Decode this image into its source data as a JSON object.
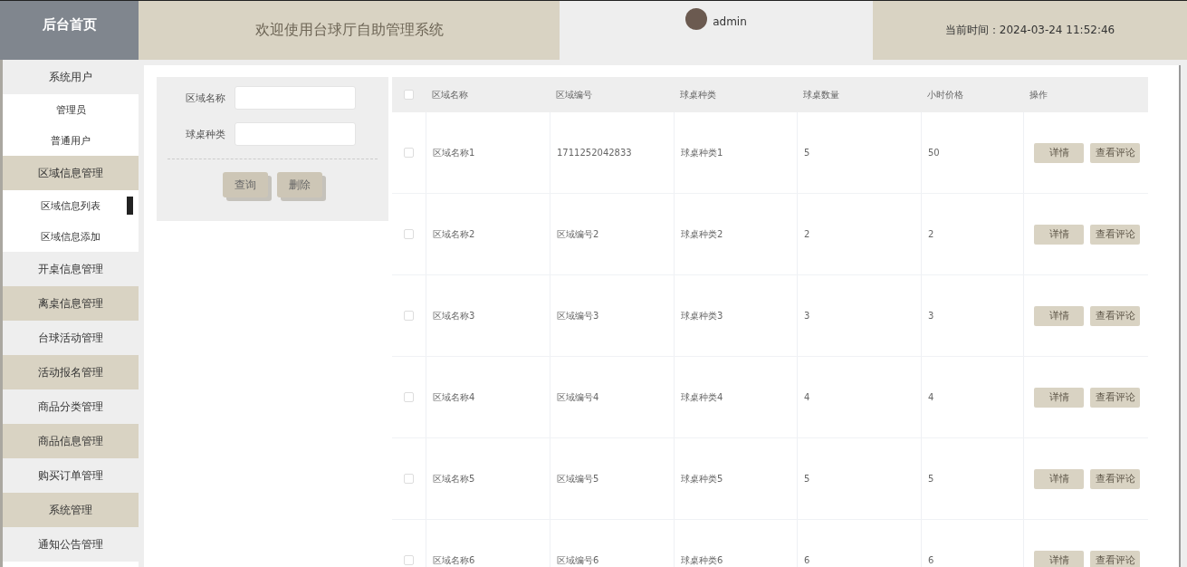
{
  "header": {
    "home": "后台首页",
    "title": "欢迎使用台球厅自助管理系统",
    "user": "admin",
    "time": "当前时间：2024-03-24 11:52:46"
  },
  "sidebar": {
    "items": [
      {
        "label": "系统用户",
        "children": [
          {
            "label": "管理员",
            "selected": false
          },
          {
            "label": "普通用户",
            "selected": false
          }
        ]
      },
      {
        "label": "区域信息管理",
        "children": [
          {
            "label": "区域信息列表",
            "selected": true
          },
          {
            "label": "区域信息添加",
            "selected": false
          }
        ]
      },
      {
        "label": "开桌信息管理"
      },
      {
        "label": "离桌信息管理"
      },
      {
        "label": "台球活动管理"
      },
      {
        "label": "活动报名管理"
      },
      {
        "label": "商品分类管理"
      },
      {
        "label": "商品信息管理"
      },
      {
        "label": "购买订单管理"
      },
      {
        "label": "系统管理"
      },
      {
        "label": "通知公告管理"
      }
    ]
  },
  "search": {
    "fields": [
      {
        "label": "区域名称"
      },
      {
        "label": "球桌种类"
      }
    ],
    "buttons": [
      "查询",
      "删除"
    ]
  },
  "table": {
    "header_checked": false,
    "columns": [
      "区域名称",
      "区域编号",
      "球桌种类",
      "球桌数量",
      "小时价格",
      "操作"
    ],
    "rows": [
      {
        "checked": false,
        "cells": [
          "区域名称1",
          "1711252042833",
          "球桌种类1",
          "5",
          "50"
        ],
        "actions": [
          "详情",
          "查看评论"
        ]
      },
      {
        "checked": false,
        "cells": [
          "区域名称2",
          "区域编号2",
          "球桌种类2",
          "2",
          "2"
        ],
        "actions": [
          "详情",
          "查看评论"
        ]
      },
      {
        "checked": false,
        "cells": [
          "区域名称3",
          "区域编号3",
          "球桌种类3",
          "3",
          "3"
        ],
        "actions": [
          "详情",
          "查看评论"
        ]
      },
      {
        "checked": false,
        "cells": [
          "区域名称4",
          "区域编号4",
          "球桌种类4",
          "4",
          "4"
        ],
        "actions": [
          "详情",
          "查看评论"
        ]
      },
      {
        "checked": false,
        "cells": [
          "区域名称5",
          "区域编号5",
          "球桌种类5",
          "5",
          "5"
        ],
        "actions": [
          "详情",
          "查看评论"
        ]
      },
      {
        "checked": false,
        "cells": [
          "区域名称6",
          "区域编号6",
          "球桌种类6",
          "6",
          "6"
        ],
        "actions": [
          "详情",
          "查看评论"
        ]
      }
    ]
  }
}
